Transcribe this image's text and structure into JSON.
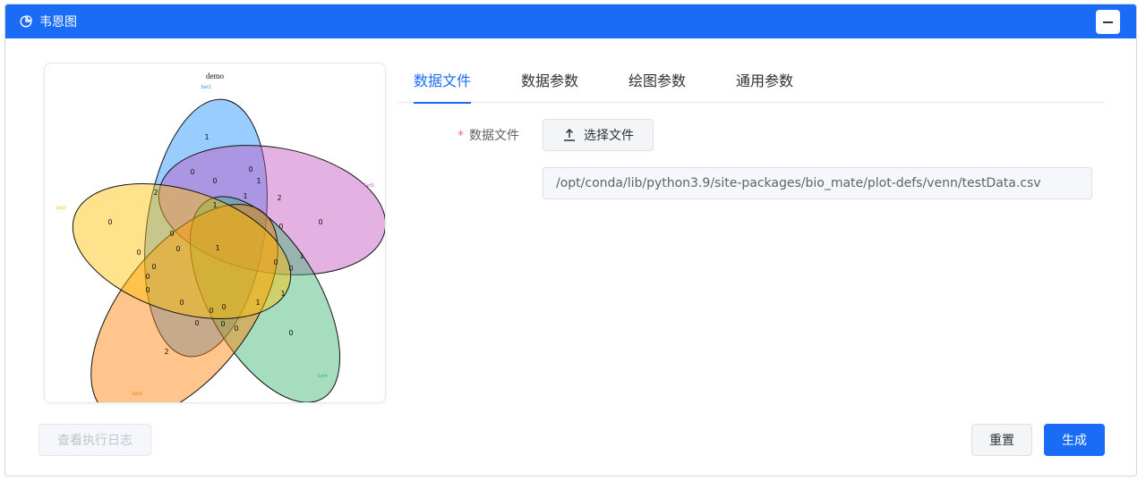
{
  "window": {
    "title": "韦恩图",
    "title_icon": "pie-chart-icon",
    "minimize_icon": "minus-icon"
  },
  "tabs": [
    {
      "label": "数据文件",
      "active": true
    },
    {
      "label": "数据参数",
      "active": false
    },
    {
      "label": "绘图参数",
      "active": false
    },
    {
      "label": "通用参数",
      "active": false
    }
  ],
  "form": {
    "data_file_label": "数据文件",
    "required_mark": "*",
    "upload_button_label": "选择文件",
    "upload_icon": "upload-icon",
    "file_path": "/opt/conda/lib/python3.9/site-packages/bio_mate/plot-defs/venn/testData.csv"
  },
  "footer": {
    "log_button_label": "查看执行日志",
    "reset_button_label": "重置",
    "generate_button_label": "生成"
  },
  "colors": {
    "primary": "#1a6cf6",
    "set1": "#1e90ff",
    "set2": "#ffc000",
    "set3": "#ff7f00",
    "set4": "#3cb371",
    "set5": "#c154c1"
  },
  "chart_data": {
    "type": "venn",
    "title": "demo",
    "sets": [
      "Set1",
      "Set5",
      "Set4",
      "Set3",
      "Set2"
    ],
    "region_labels": [
      "1",
      "0",
      "0",
      "2",
      "0",
      "0",
      "0",
      "1",
      "2",
      "1",
      "0",
      "0",
      "0",
      "0",
      "0",
      "1",
      "0",
      "0",
      "1",
      "0",
      "0",
      "0",
      "0",
      "1",
      "1",
      "0",
      "0",
      "0",
      "0",
      "0",
      "2",
      "1"
    ]
  }
}
